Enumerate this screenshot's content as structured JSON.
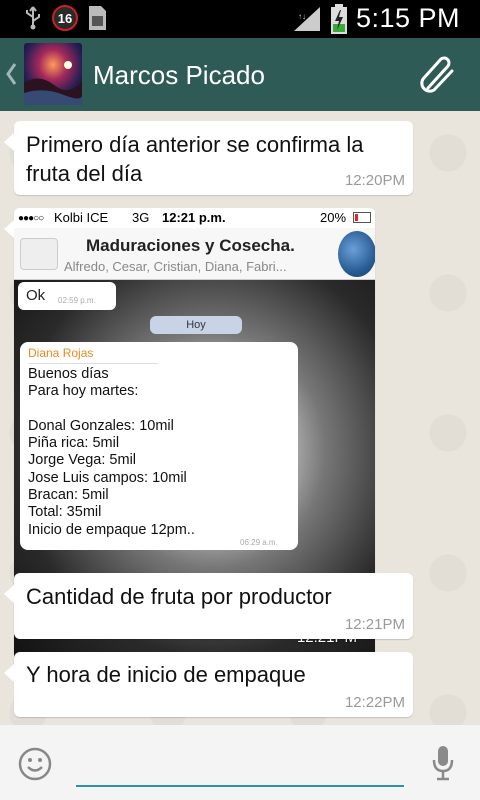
{
  "status_bar": {
    "notification_count": "16",
    "time": "5:15 PM",
    "icons": [
      "usb-icon",
      "notification-badge",
      "sim-icon",
      "signal-icon",
      "battery-charging-icon"
    ]
  },
  "header": {
    "contact_name": "Marcos Picado",
    "icons": [
      "back-icon",
      "avatar",
      "attach-icon"
    ]
  },
  "messages": [
    {
      "text_lines": [
        "Primero día anterior se confirma la",
        "fruta del día"
      ],
      "time": "12:20PM"
    },
    {
      "type": "image",
      "time": "12:21PM",
      "screenshot": {
        "carrier": "Kolbi ICE",
        "network": "3G",
        "time": "12:21 p.m.",
        "battery": "20%",
        "title": "Maduraciones y Cosecha.",
        "subtitle": "Alfredo, Cesar, Cristian, Diana, Fabri...",
        "ok_text": "Ok",
        "ok_time": "02:59 p.m.",
        "day_label": "Hoy",
        "sender": "Diana Rojas",
        "lines": [
          "Buenos días",
          "Para hoy martes:",
          "",
          "Donal Gonzales: 10mil",
          "Piña rica: 5mil",
          "Jorge Vega: 5mil",
          "Jose Luis campos: 10mil",
          "Bracan: 5mil",
          "Total: 35mil",
          "Inicio de empaque 12pm.."
        ],
        "msg_time": "06:29 a.m."
      }
    },
    {
      "text_lines": [
        "Cantidad de fruta por productor"
      ],
      "time": "12:21PM"
    },
    {
      "text_lines": [
        "Y hora de inicio de empaque"
      ],
      "time": "12:22PM"
    }
  ],
  "input_bar": {
    "placeholder": "",
    "icons": [
      "emoji-icon",
      "mic-icon"
    ]
  },
  "colors": {
    "header": "#2e5b56",
    "chat_background": "#e9e4dc",
    "bubble": "#ffffff",
    "timestamp": "#9a9a9a",
    "input_underline": "#2e8fa8",
    "sender_name": "#e98a1f"
  }
}
